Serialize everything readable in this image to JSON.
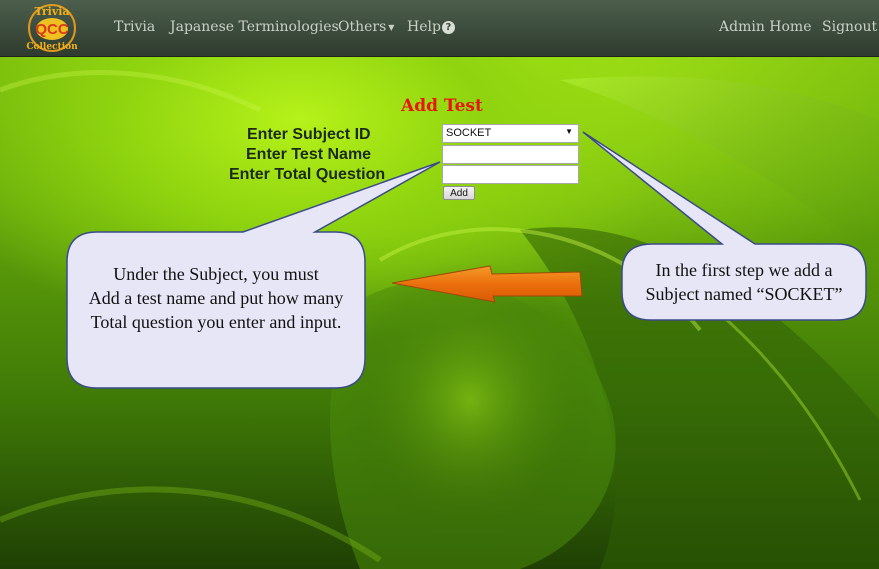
{
  "brand": {
    "logo_text_top": "Trivia",
    "logo_text_mid": "QCC",
    "logo_text_bottom": "Collection"
  },
  "nav": {
    "items": [
      "Trivia",
      "Japanese Terminologies",
      "Others",
      "Help"
    ],
    "right_items": [
      "Admin Home",
      "Signout"
    ]
  },
  "form": {
    "title": "Add Test",
    "subject_label": "Enter Subject ID",
    "test_name_label": "Enter Test Name",
    "total_question_label": "Enter Total Question",
    "subject_selected": "SOCKET",
    "test_name_value": "",
    "total_question_value": "",
    "add_button": "Add"
  },
  "annotations": {
    "left_callout": [
      "Under the Subject, you must",
      "Add a test name and put how many",
      "Total question you enter and input."
    ],
    "right_callout": [
      "In the first step we add a",
      "Subject named “SOCKET”"
    ]
  },
  "colors": {
    "title_red": "#e8150e",
    "callout_fill": "#e6e6f7",
    "arrow_orange": "#f07a12"
  }
}
